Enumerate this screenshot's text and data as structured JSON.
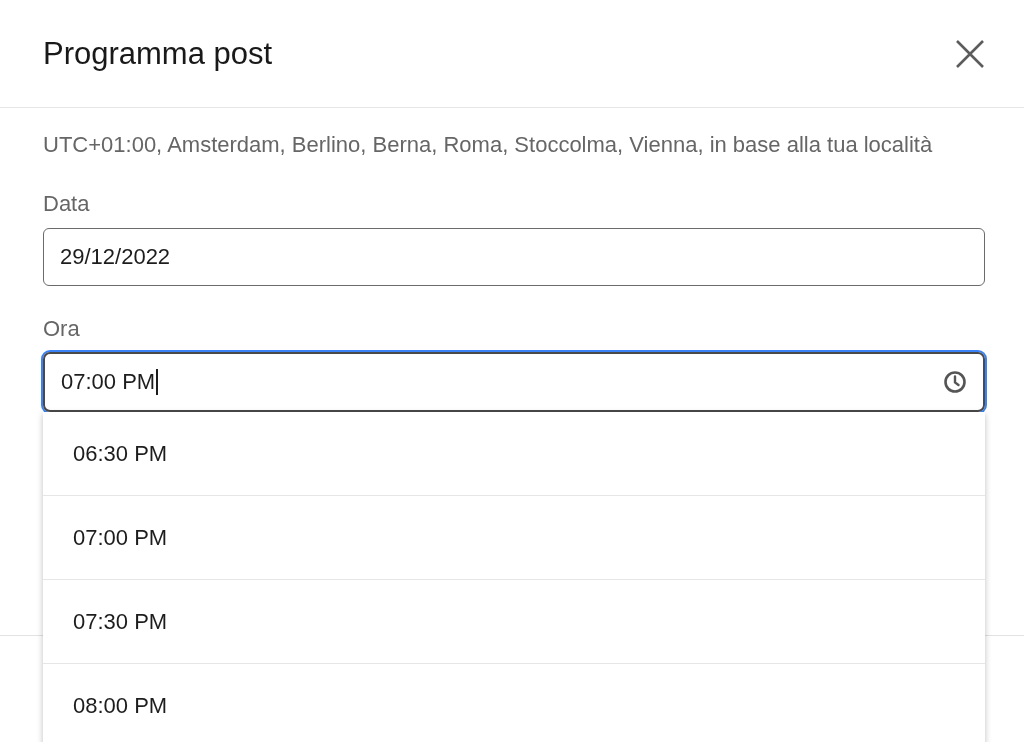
{
  "dialog": {
    "title": "Programma post",
    "timezone_note": "UTC+01:00, Amsterdam, Berlino, Berna, Roma, Stoccolma, Vienna, in base alla tua località"
  },
  "date_field": {
    "label": "Data",
    "value": "29/12/2022"
  },
  "time_field": {
    "label": "Ora",
    "value": "07:00 PM",
    "focused": true
  },
  "time_options": [
    {
      "label": "06:30 PM"
    },
    {
      "label": "07:00 PM"
    },
    {
      "label": "07:30 PM"
    },
    {
      "label": "08:00 PM"
    }
  ]
}
